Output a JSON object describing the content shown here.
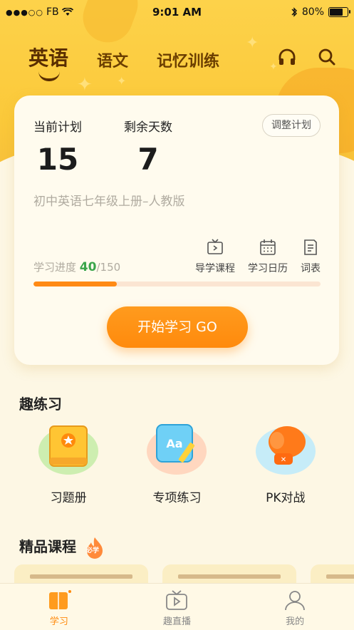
{
  "status_bar": {
    "signal": "●●●○○",
    "carrier": "FB",
    "time": "9:01 AM",
    "battery": "80%"
  },
  "top_tabs": [
    {
      "label": "英语",
      "active": true
    },
    {
      "label": "语文",
      "active": false
    },
    {
      "label": "记忆训练",
      "active": false
    }
  ],
  "top_icons": [
    "headphones-icon",
    "search-icon"
  ],
  "plan": {
    "current_plan_label": "当前计划",
    "current_plan_value": "15",
    "days_left_label": "剩余天数",
    "days_left_value": "7",
    "adjust_label": "调整计划",
    "book_name": "初中英语七年级上册–人教版",
    "progress_label": "学习进度",
    "progress_done": "40",
    "progress_total": "/150",
    "progress_fraction": 0.29,
    "tools": [
      {
        "label": "导学课程",
        "icon": "tv-icon"
      },
      {
        "label": "学习日历",
        "icon": "calendar-icon"
      },
      {
        "label": "词表",
        "icon": "wordlist-icon"
      }
    ],
    "start_label": "开始学习 GO"
  },
  "fun_practice": {
    "title": "趣练习",
    "items": [
      {
        "label": "习题册",
        "icon": "workbook-icon"
      },
      {
        "label": "专项练习",
        "icon": "special-practice-icon"
      },
      {
        "label": "PK对战",
        "icon": "boxing-glove-icon"
      }
    ]
  },
  "premium": {
    "title": "精品课程",
    "badge": "必学"
  },
  "bottom_nav": [
    {
      "label": "学习",
      "active": true,
      "icon": "study-book-icon"
    },
    {
      "label": "趣直播",
      "active": false,
      "icon": "live-tv-icon"
    },
    {
      "label": "我的",
      "active": false,
      "icon": "profile-icon"
    }
  ],
  "colors": {
    "accent": "#ff8a0c",
    "header_yellow": "#fdd24a",
    "progress_green": "#3aa54b"
  }
}
